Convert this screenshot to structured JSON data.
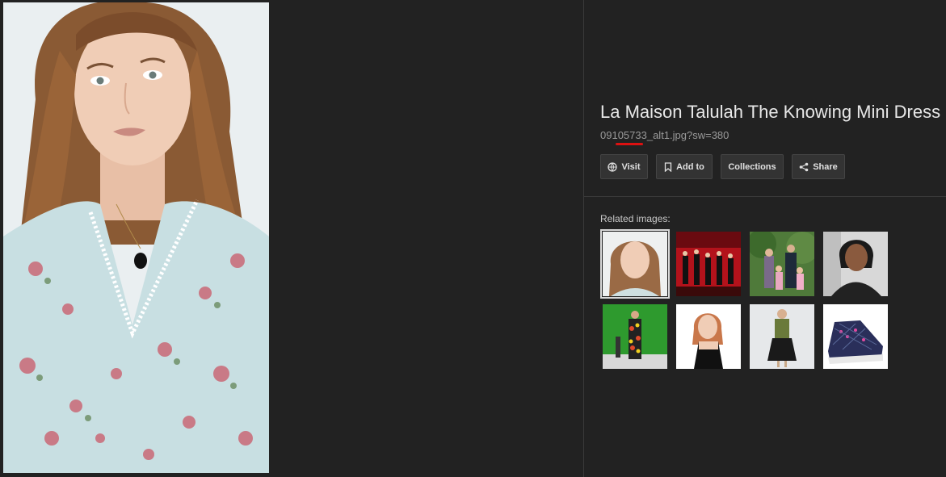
{
  "title": "La Maison Talulah The Knowing Mini Dress",
  "filename": "09105733_alt1.jpg?sw=380",
  "buttons": {
    "visit": "Visit",
    "add_to": "Add to",
    "collections": "Collections",
    "share": "Share"
  },
  "related_label": "Related images:",
  "colors": {
    "background": "#222222",
    "accent_underline": "#dd1111"
  },
  "related_images": [
    {
      "subject": "woman-portrait"
    },
    {
      "subject": "runway-red-stage"
    },
    {
      "subject": "family-in-park"
    },
    {
      "subject": "woman-black-jacket"
    },
    {
      "subject": "runway-green-backdrop"
    },
    {
      "subject": "girl-white-background"
    },
    {
      "subject": "woman-olive-top"
    },
    {
      "subject": "sparkle-sneaker"
    }
  ]
}
